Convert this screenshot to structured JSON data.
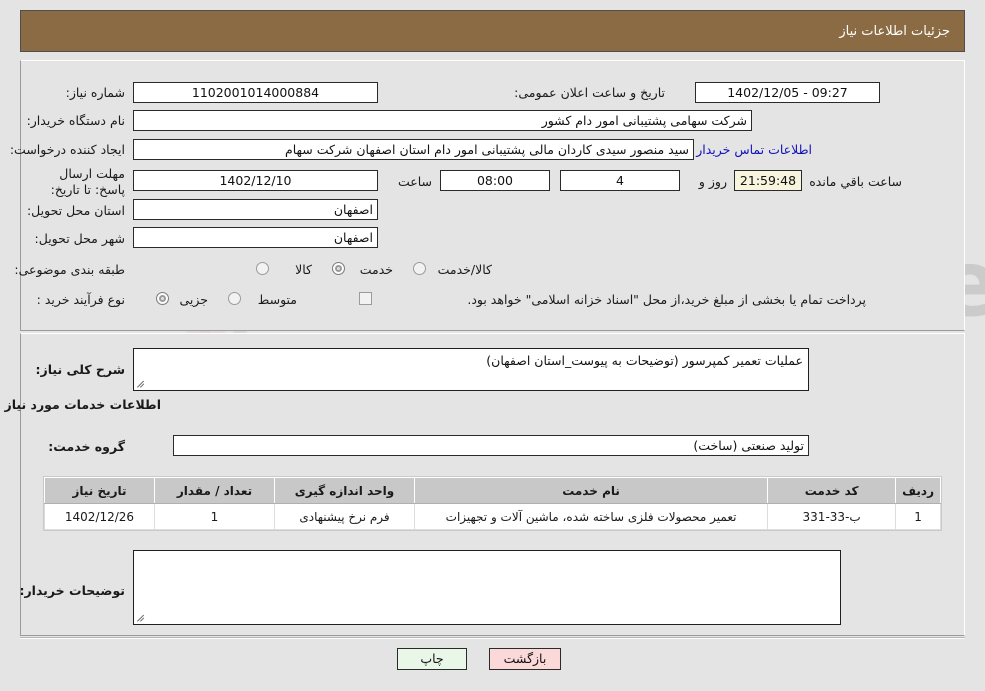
{
  "header": {
    "title": "جزئیات اطلاعات نیاز"
  },
  "top_form": {
    "need_number_label": "شماره نیاز:",
    "need_number_value": "1102001014000884",
    "announce_label": "تاریخ و ساعت اعلان عمومی:",
    "announce_value": "09:27 - 1402/12/05",
    "buyer_org_label": "نام دستگاه خریدار:",
    "buyer_org_value": "شرکت سهامی پشتیبانی امور دام کشور",
    "creator_label": "ایجاد کننده درخواست:",
    "creator_value": "سید منصور سیدی کاردان مالی پشتیبانی امور دام استان اصفهان شرکت سهام",
    "contact_link": "اطلاعات تماس خریدار",
    "deadline_label": "مهلت ارسال پاسخ: تا تاریخ:",
    "deadline_date": "1402/12/10",
    "hour_label": "ساعت",
    "hour_value": "08:00",
    "days_value": "4",
    "days_label": "روز و",
    "countdown_value": "21:59:48",
    "remaining_label": "ساعت باقي مانده",
    "province_label": "استان محل تحویل:",
    "province_value": "اصفهان",
    "city_label": "شهر محل تحویل:",
    "city_value": "اصفهان",
    "category_label": "طبقه بندی موضوعی:",
    "category_options": [
      "کالا",
      "خدمت",
      "کالا/خدمت"
    ],
    "category_selected": "خدمت",
    "process_label": "نوع فرآیند خرید :",
    "process_options": [
      "جزیی",
      "متوسط"
    ],
    "process_selected": "جزیی",
    "treasury_note": "پرداخت تمام یا بخشی از مبلغ خرید،از محل \"اسناد خزانه اسلامی\" خواهد بود.",
    "treasury_checked": false
  },
  "middle": {
    "summary_label": "شرح کلی نیاز:",
    "summary_value": "عملیات تعمیر کمپرسور (توضیحات به پیوست_استان اصفهان)",
    "section_heading": "اطلاعات خدمات مورد نیاز",
    "service_group_label": "گروه خدمت:",
    "service_group_value": "تولید صنعتی (ساخت)",
    "buyer_notes_label": "توضیحات خریدار:",
    "buyer_notes_value": ""
  },
  "table": {
    "columns": [
      "ردیف",
      "کد خدمت",
      "نام خدمت",
      "واحد اندازه گیری",
      "تعداد / مقدار",
      "تاریخ نیاز"
    ],
    "rows": [
      {
        "radif": "1",
        "code": "ب-33-331",
        "name": "تعمیر محصولات فلزی ساخته شده، ماشین آلات و تجهیزات",
        "unit": "فرم نرخ پیشنهادی",
        "qty": "1",
        "date": "1402/12/26"
      }
    ]
  },
  "buttons": {
    "print": "چاپ",
    "back": "بازگشت"
  },
  "watermark": {
    "text": "AnaTender.net"
  },
  "colors": {
    "header_bar": "#8a6b43",
    "page_bg": "#e4e4e4",
    "link": "#1111bb",
    "table_header": "#c8c8c8",
    "print_btn": "#e8f7e8",
    "back_btn": "#fbd9d9",
    "countdown_bg": "#f7f5dd"
  }
}
